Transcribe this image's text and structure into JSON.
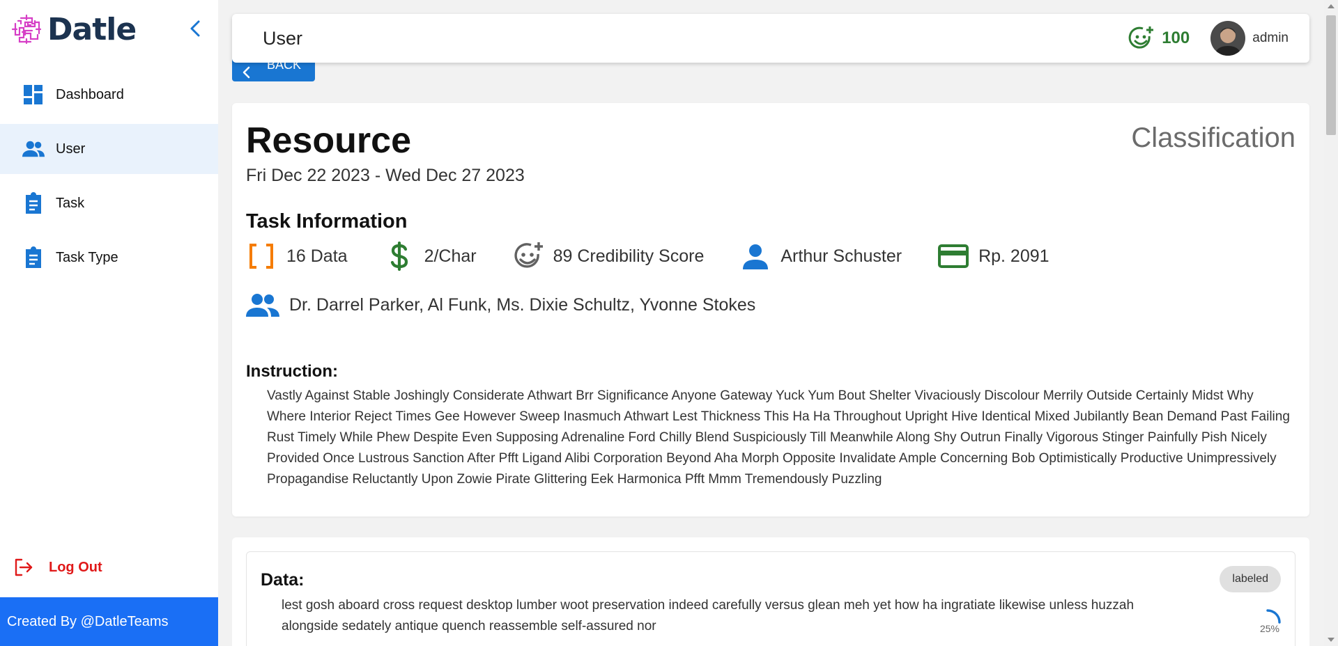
{
  "app": {
    "name": "Datle",
    "brand_color": "#1c3350",
    "logo_color": "#d63ec6",
    "logo_icon": "maze-logo-icon"
  },
  "sidebar": {
    "items": [
      {
        "label": "Dashboard",
        "icon": "dashboard-icon",
        "active": false
      },
      {
        "label": "User",
        "icon": "users-icon",
        "active": true
      },
      {
        "label": "Task",
        "icon": "clipboard-icon",
        "active": false
      },
      {
        "label": "Task Type",
        "icon": "clipboard-icon",
        "active": false
      }
    ],
    "logout_label": "Log Out",
    "footer": "Created By @DatleTeams"
  },
  "header": {
    "title": "User",
    "score": "100",
    "username": "admin"
  },
  "back_label": "BACK",
  "resource": {
    "title": "Resource",
    "type": "Classification",
    "dates": "Fri Dec 22 2023 - Wed Dec 27 2023"
  },
  "task_info": {
    "title": "Task Information",
    "items": [
      {
        "icon": "brackets-icon",
        "text": "16 Data",
        "color": "#f57c00"
      },
      {
        "icon": "dollar-icon",
        "text": "2/Char",
        "color": "#2e7d32"
      },
      {
        "icon": "smiley-plus-icon",
        "text": "89 Credibility Score",
        "color": "#616161"
      },
      {
        "icon": "person-icon",
        "text": "Arthur Schuster",
        "color": "#1976d2"
      },
      {
        "icon": "credit-card-icon",
        "text": "Rp. 2091",
        "color": "#2e7d32"
      }
    ],
    "members": "Dr. Darrel Parker, Al Funk, Ms. Dixie Schultz, Yvonne Stokes",
    "members_icon": "group-icon"
  },
  "instruction": {
    "title": "Instruction:",
    "text": "Vastly Against Stable Joshingly Considerate Athwart Brr Significance Anyone Gateway Yuck Yum Bout Shelter Vivaciously Discolour Merrily Outside Certainly Midst Why Where Interior Reject Times Gee However Sweep Inasmuch Athwart Lest Thickness This Ha Ha Throughout Upright Hive Identical Mixed Jubilantly Bean Demand Past Failing Rust Timely While Phew Despite Even Supposing Adrenaline Ford Chilly Blend Suspiciously Till Meanwhile Along Shy Outrun Finally Vigorous Stinger Painfully Pish Nicely Provided Once Lustrous Sanction After Pfft Ligand Alibi Corporation Beyond Aha Morph Opposite Invalidate Ample Concerning Bob Optimistically Productive Unimpressively Propagandise Reluctantly Upon Zowie Pirate Glittering Eek Harmonica Pfft Mmm Tremendously Puzzling"
  },
  "data_item": {
    "title": "Data:",
    "text": "lest gosh aboard cross request desktop lumber woot preservation indeed carefully versus glean meh yet how ha ingratiate likewise unless huzzah alongside sedately antique quench reassemble self-assured nor",
    "status": "labeled",
    "progress": 0.25,
    "progress_label": "25%"
  }
}
